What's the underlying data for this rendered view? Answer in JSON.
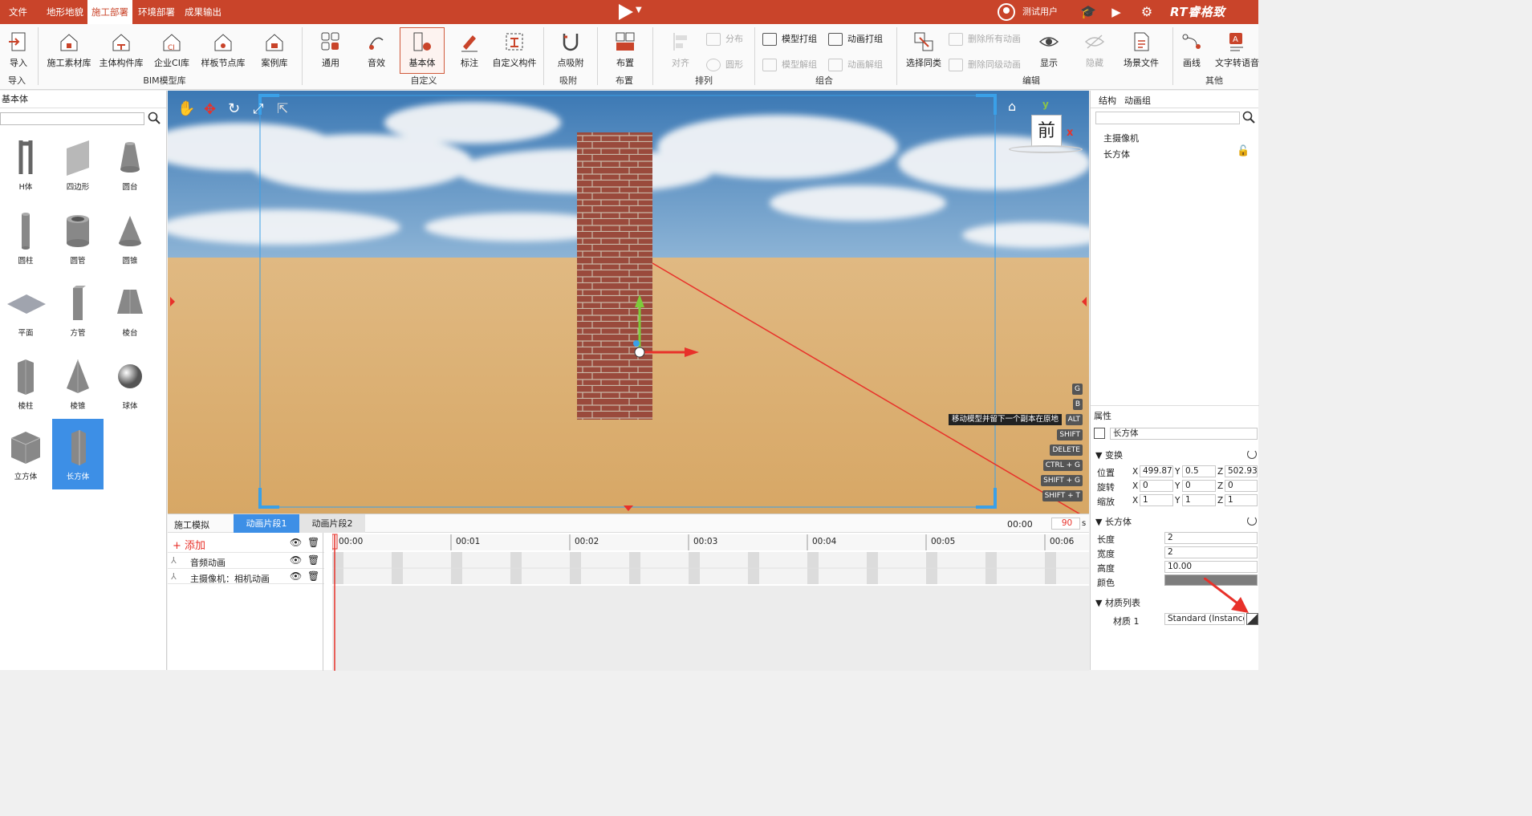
{
  "menubar": {
    "items": [
      "文件",
      "地形地貌",
      "施工部署",
      "环境部署",
      "成果输出"
    ],
    "active": "施工部署",
    "user": "测试用户",
    "brand": "RT睿格致"
  },
  "ribbon": {
    "import": {
      "label": "导入",
      "group": "导入"
    },
    "bim": {
      "items": [
        "施工素材库",
        "主体构件库",
        "企业CI库",
        "样板节点库",
        "案例库"
      ],
      "group": "BIM模型库"
    },
    "custom": {
      "items": [
        "通用",
        "音效",
        "基本体",
        "标注",
        "自定义构件"
      ],
      "group": "自定义"
    },
    "snap": {
      "label": "点吸附",
      "group": "吸附"
    },
    "layout": {
      "label": "布置",
      "group": "布置"
    },
    "arrange": {
      "align": "对齐",
      "distribute": "分布",
      "circle": "圆形",
      "group": "排列"
    },
    "combine": {
      "items": [
        "模型打组",
        "模型解组",
        "动画打组",
        "动画解组"
      ],
      "group": "组合"
    },
    "edit": {
      "select_same": "选择同类",
      "del_all_anim": "删除所有动画",
      "del_same_anim": "删除同级动画",
      "show": "显示",
      "hide": "隐藏",
      "scene_file": "场景文件",
      "group": "编辑"
    },
    "other": {
      "draw_line": "画线",
      "tts": "文字转语音",
      "group": "其他"
    }
  },
  "left": {
    "title": "基本体",
    "search_value": "",
    "shapes": [
      "H体",
      "四边形",
      "圆台",
      "圆柱",
      "圆管",
      "圆锥",
      "平面",
      "方管",
      "棱台",
      "棱柱",
      "棱锥",
      "球体",
      "立方体",
      "长方体"
    ],
    "selected": "长方体"
  },
  "viewport": {
    "gizmo_face": "前",
    "axis_y": "y",
    "axis_x": "x",
    "tooltip": "移动模型并留下一个副本在原地",
    "shortcuts": [
      "G",
      "B",
      "ALT",
      "SHIFT",
      "DELETE",
      "CTRL + G",
      "SHIFT + G",
      "SHIFT + T"
    ]
  },
  "timeline": {
    "tabs": [
      "施工模拟",
      "动画片段1",
      "动画片段2"
    ],
    "active_tab": "动画片段1",
    "add": "+ 添加",
    "time": "00:00",
    "duration": "90",
    "unit": "s",
    "tracks": [
      "音频动画",
      "主摄像机：相机动画"
    ],
    "ticks": [
      "00:00",
      "00:01",
      "00:02",
      "00:03",
      "00:04",
      "00:05",
      "00:06"
    ]
  },
  "right": {
    "tabs": [
      "结构",
      "动画组"
    ],
    "tree": [
      "主摄像机",
      "长方体"
    ],
    "props_title": "属性",
    "object_name": "长方体",
    "transform": {
      "title": "变换",
      "position_label": "位置",
      "position": [
        "499.87",
        "0.5",
        "502.93"
      ],
      "rotation_label": "旋转",
      "rotation": [
        "0",
        "0",
        "0"
      ],
      "scale_label": "缩放",
      "scale": [
        "1",
        "1",
        "1"
      ]
    },
    "box": {
      "title": "长方体",
      "length_label": "长度",
      "length": "2",
      "width_label": "宽度",
      "width": "2",
      "height_label": "高度",
      "height": "10.00",
      "color_label": "颜色"
    },
    "materials": {
      "title": "材质列表",
      "label": "材质 1",
      "value": "Standard (Instance)"
    }
  },
  "colors": {
    "brand": "#c9442a",
    "selected": "#3d8fe6",
    "annotation": "#e8312a"
  }
}
